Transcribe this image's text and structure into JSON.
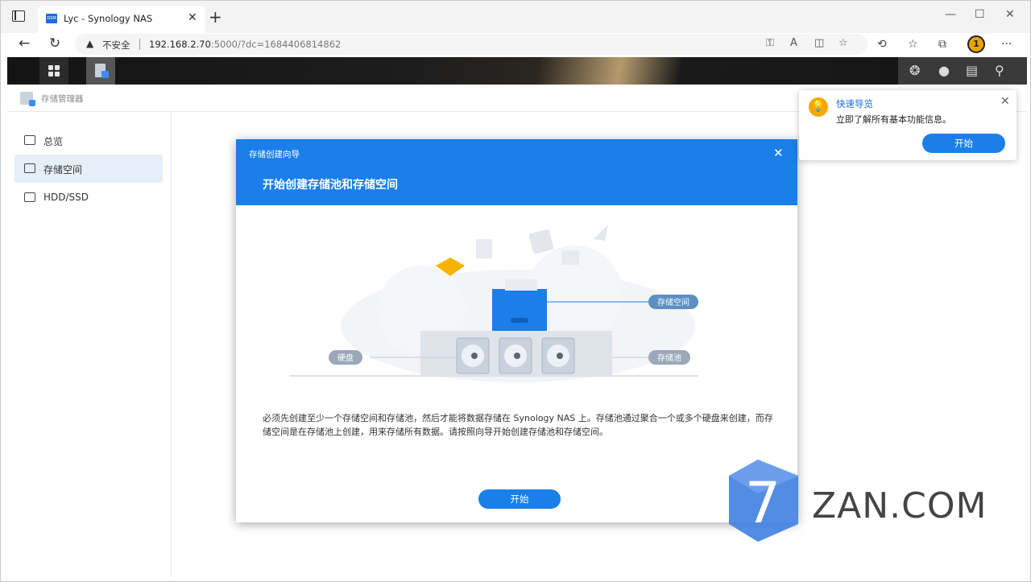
{
  "browser": {
    "tab_title": "Lyc - Synology NAS",
    "favicon_text": "DSM",
    "security_label": "不安全",
    "url_host": "192.168.2.70",
    "url_path": ":5000/?dc=1684406814862",
    "profile_letter": "1"
  },
  "app": {
    "name": "存储管理器"
  },
  "sidebar": {
    "items": [
      {
        "label": "总览",
        "icon": "overview-icon",
        "active": false
      },
      {
        "label": "存储空间",
        "icon": "volume-icon",
        "active": true
      },
      {
        "label": "HDD/SSD",
        "icon": "disk-icon",
        "active": false
      }
    ]
  },
  "dialog": {
    "window_title": "存储创建向导",
    "heading": "开始创建存储池和存储空间",
    "illustration": {
      "volume_label": "存储空间",
      "pool_label": "存储池",
      "disk_label": "硬盘"
    },
    "description": "必须先创建至少一个存储空间和存储池，然后才能将数据存储在 Synology NAS 上。存储池通过聚合一个或多个硬盘来创建，而存储空间是在存储池上创建，用来存储所有数据。请按照向导开始创建存储池和存储空间。",
    "start_label": "开始"
  },
  "tour": {
    "title": "快速导览",
    "message": "立即了解所有基本功能信息。",
    "start_label": "开始"
  },
  "watermark": {
    "text": "ZAN.COM",
    "logo_glyph": "7"
  },
  "colors": {
    "accent": "#1a7fe8",
    "tour_bulb": "#f5a700"
  }
}
